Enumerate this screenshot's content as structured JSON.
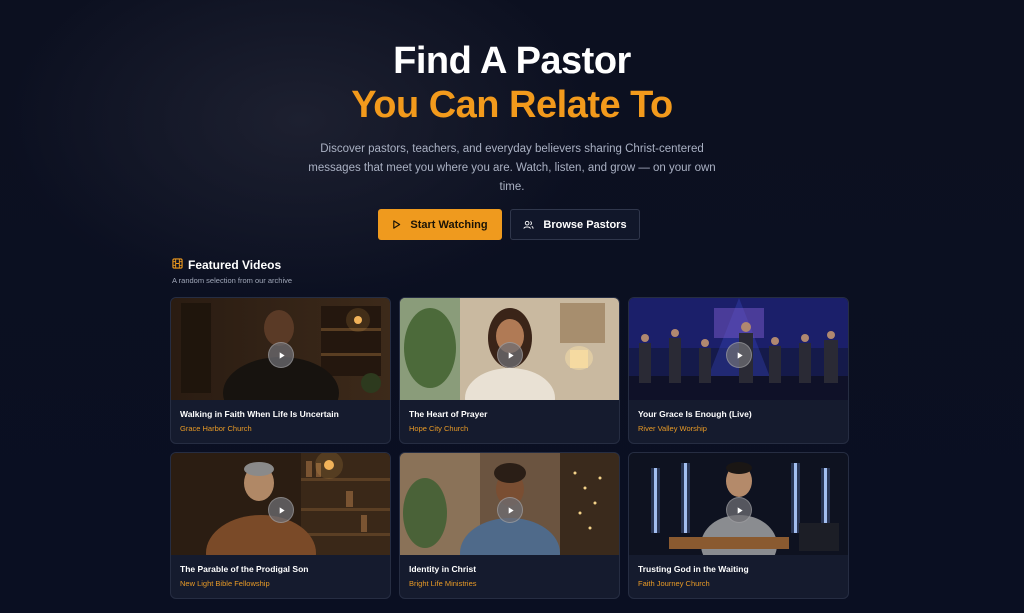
{
  "hero": {
    "title_line1": "Find A Pastor",
    "title_line2": "You Can Relate To",
    "description": "Discover pastors, teachers, and everyday believers sharing Christ-centered messages that meet you where you are. Watch, listen, and grow — on your own time.",
    "primary_button": "Start Watching",
    "secondary_button": "Browse Pastors"
  },
  "featured": {
    "heading": "Featured Videos",
    "subheading": "A random selection from our archive",
    "videos": [
      {
        "title": "Walking in Faith When Life Is Uncertain",
        "church": "Grace Harbor Church"
      },
      {
        "title": "The Heart of Prayer",
        "church": "Hope City Church"
      },
      {
        "title": "Your Grace Is Enough (Live)",
        "church": "River Valley Worship"
      },
      {
        "title": "The Parable of the Prodigal Son",
        "church": "New Light Bible Fellowship"
      },
      {
        "title": "Identity in Christ",
        "church": "Bright Life Ministries"
      },
      {
        "title": "Trusting God in the Waiting",
        "church": "Faith Journey Church"
      }
    ]
  },
  "colors": {
    "accent": "#ef9a1e",
    "title_accent": "#f29a1c",
    "background": "#0b1022",
    "card": "#151b2e"
  },
  "icons": {
    "primary_button": "play-icon",
    "secondary_button": "users-icon",
    "section": "film-icon",
    "card_overlay": "play-circle-icon"
  }
}
